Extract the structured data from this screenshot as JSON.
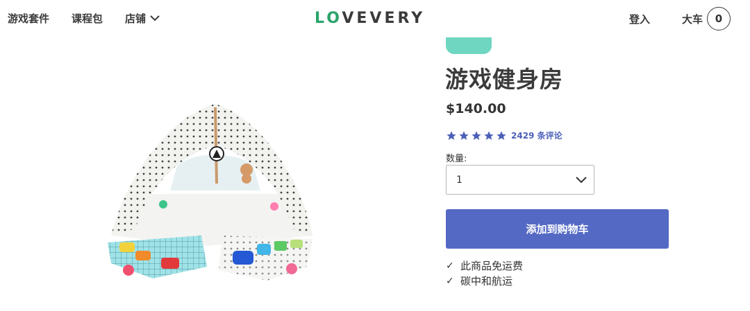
{
  "nav": {
    "items": [
      "游戏套件",
      "课程包"
    ],
    "store_label": "店铺",
    "login": "登入",
    "cart_label": "大车",
    "cart_count": "0"
  },
  "logo": {
    "lo": "LO",
    "rest": "VEVERY"
  },
  "product": {
    "badge": "",
    "title": "游戏健身房",
    "price": "$140.00",
    "rating": 5,
    "reviews": "2429 条评论",
    "quantity_label": "数量:",
    "quantity_value": "1",
    "add_to_cart": "添加到购物车",
    "features": [
      "此商品免运费",
      "碳中和航运"
    ]
  },
  "colors": {
    "accent": "#5469c4",
    "brand_green": "#2aa36b",
    "badge": "#6fd6c1",
    "star": "#4c60b8"
  }
}
